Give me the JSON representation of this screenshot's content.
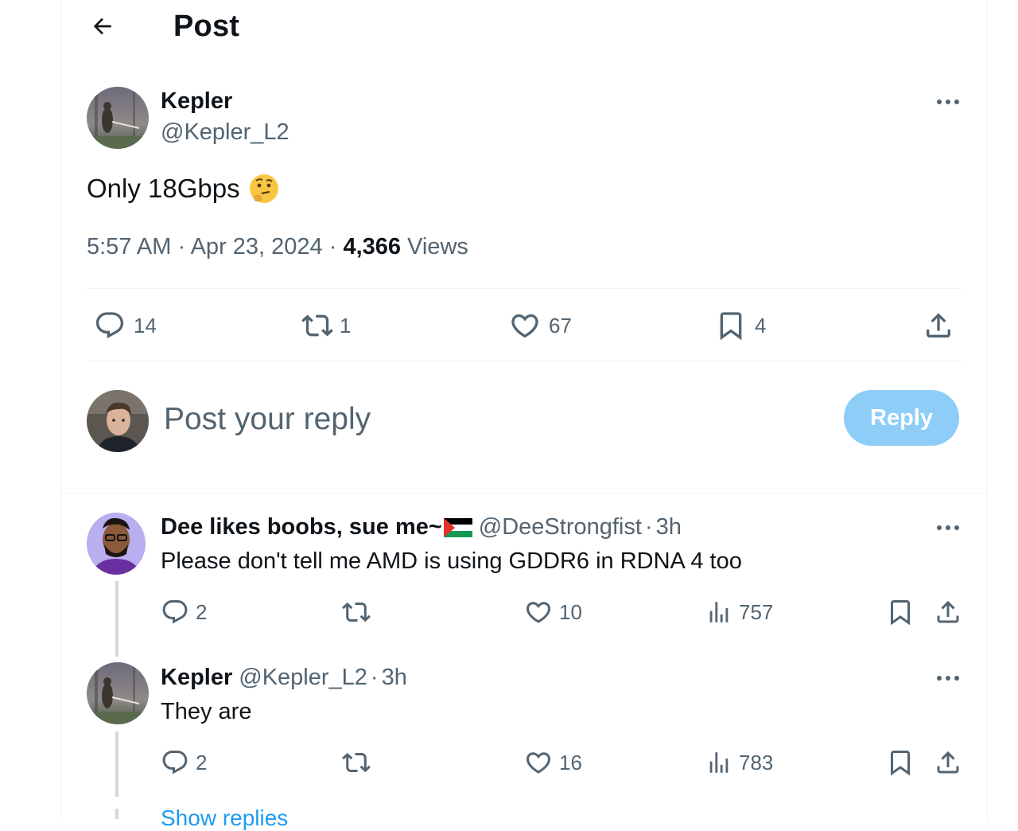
{
  "header": {
    "title": "Post"
  },
  "post": {
    "author_name": "Kepler",
    "author_handle": "@Kepler_L2",
    "text": "Only 18Gbps",
    "emoji": "🤔",
    "time": "5:57 AM",
    "date": "Apr 23, 2024",
    "views_count": "4,366",
    "views_label": "Views",
    "replies": "14",
    "reposts": "1",
    "likes": "67",
    "bookmarks": "4"
  },
  "composer": {
    "placeholder": "Post your reply",
    "reply_label": "Reply"
  },
  "replies": [
    {
      "author_name": "Dee likes boobs, sue me~",
      "author_handle": "@DeeStrongfist",
      "time": "3h",
      "text": "Please don't tell me AMD is using GDDR6 in RDNA 4 too",
      "replies": "2",
      "reposts": "",
      "likes": "10",
      "views": "757"
    },
    {
      "author_name": "Kepler",
      "author_handle": "@Kepler_L2",
      "time": "3h",
      "text": "They are",
      "replies": "2",
      "reposts": "",
      "likes": "16",
      "views": "783"
    }
  ],
  "show_replies_label": "Show replies",
  "colors": {
    "accent": "#1d9bf0",
    "reply_button": "#8ecdf8",
    "muted": "#536471"
  }
}
